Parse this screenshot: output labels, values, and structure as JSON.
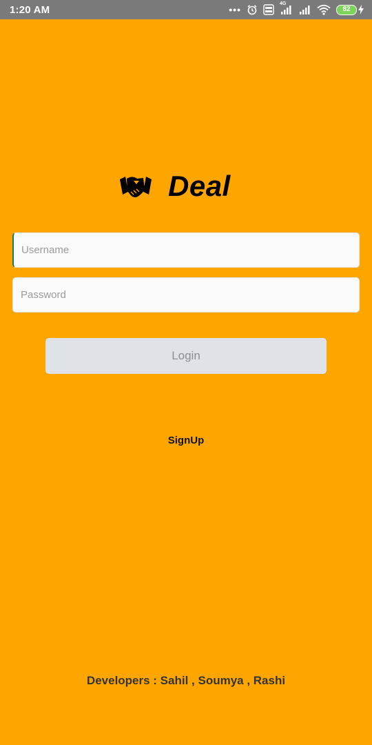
{
  "status_bar": {
    "time": "1:20 AM",
    "more_dots": "•••",
    "network_type": "4G",
    "battery_level": "82"
  },
  "logo": {
    "icon": "handshake-icon",
    "title": "Deal"
  },
  "form": {
    "username_placeholder": "Username",
    "password_placeholder": "Password",
    "login_label": "Login",
    "signup_label": "SignUp"
  },
  "footer": {
    "developers_text": "Developers : Sahil , Soumya , Rashi"
  },
  "colors": {
    "background": "#ffa500",
    "status_bar": "#7a7a7a",
    "login_button": "#dfe2e6",
    "battery": "#7ed35a"
  }
}
